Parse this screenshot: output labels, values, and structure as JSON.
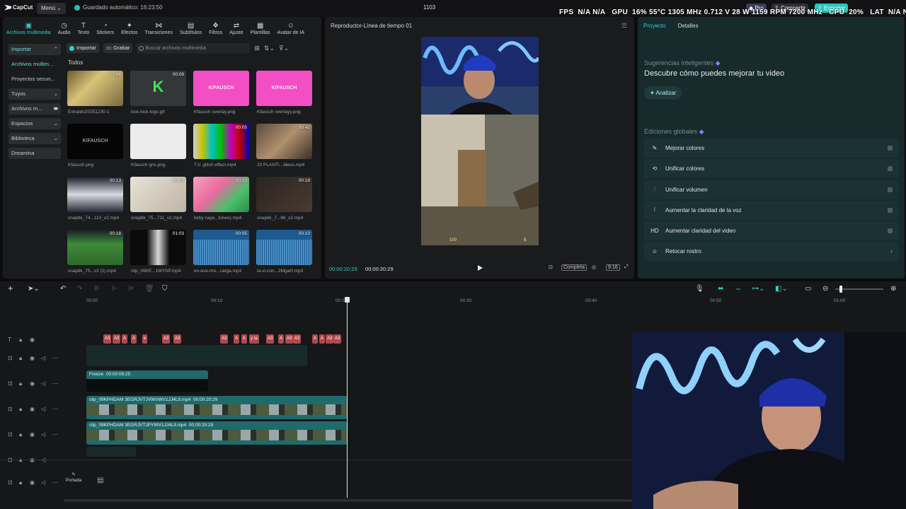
{
  "app": {
    "logo_text": "CapCut",
    "menu_label": "Menú",
    "autosave": "Guardado automático: 16:23:50",
    "title": "1103",
    "pro_label": "Pro",
    "share_label": "Compartir",
    "export_label": "Exportar"
  },
  "overlay": {
    "fps_label": "FPS",
    "fps_value": "N/A N/A",
    "gpu_label": "GPU",
    "gpu_stats": "16% 55°C 1305 MHz 0.712 V 28 W 1159 RPM 7200 MHz",
    "cpu_label": "CPU",
    "cpu_value": "20%",
    "lat_label": "LAT",
    "lat_value": "N/A N/A"
  },
  "toolbar": [
    {
      "label": "Archivos multimedia",
      "icon": "media-icon",
      "glyph": "▣",
      "active": true
    },
    {
      "label": "Audio",
      "icon": "audio-icon",
      "glyph": "◷"
    },
    {
      "label": "Texto",
      "icon": "text-icon",
      "glyph": "T"
    },
    {
      "label": "Stickers",
      "icon": "sticker-icon",
      "glyph": "◔"
    },
    {
      "label": "Efectos",
      "icon": "effects-icon",
      "glyph": "✦"
    },
    {
      "label": "Transiciones",
      "icon": "transitions-icon",
      "glyph": "⋈"
    },
    {
      "label": "Subtítulos",
      "icon": "subtitles-icon",
      "glyph": "▤"
    },
    {
      "label": "Filtros",
      "icon": "filters-icon",
      "glyph": "❖"
    },
    {
      "label": "Ajuste",
      "icon": "adjust-icon",
      "glyph": "⇄"
    },
    {
      "label": "Plantillas",
      "icon": "templates-icon",
      "glyph": "▦"
    },
    {
      "label": "Avatar de IA",
      "icon": "ai-avatar-icon",
      "glyph": "☺"
    }
  ],
  "sidenav": [
    {
      "label": "Importar",
      "chev": "⌃",
      "sel": true,
      "hl": true
    },
    {
      "label": "Archivos multim...",
      "chev": "",
      "hl": true
    },
    {
      "label": "Proyectos secun...",
      "chev": ""
    },
    {
      "label": "Tuyos",
      "chev": "⌄",
      "sel": true
    },
    {
      "label": "Archivos m...",
      "chev": "⬬",
      "sel": true
    },
    {
      "label": "Espacios",
      "chev": "⌄",
      "sel": true
    },
    {
      "label": "Biblioteca",
      "chev": "⌄",
      "sel": true
    },
    {
      "label": "Dreamina",
      "chev": "",
      "sel": true
    }
  ],
  "media": {
    "import_label": "Importar",
    "record_label": "Grabar",
    "search_placeholder": "Buscar archivos multimedia",
    "section_label": "Todos",
    "items": [
      {
        "name": "Extraido20251230-1",
        "dur": "00:06",
        "bg": "linear-gradient(135deg,#6b5a2f,#d8c27a 40%,#7a6a3f)"
      },
      {
        "name": "kick-kick-logo.gif",
        "dur": "00:09",
        "bg": "#34373a",
        "logo": "K",
        "logo_color": "#3ee64a"
      },
      {
        "name": "Kfausch overlay.png",
        "dur": "",
        "bg": "#f14fc3",
        "logo": "K/FAUSCH",
        "logo_color": "#ffe3f6"
      },
      {
        "name": "Kfausch overlayy.png",
        "dur": "",
        "bg": "#f14fc3",
        "logo": "K/FAUSCH",
        "logo_color": "#ffe3f6"
      },
      {
        "name": "Kfausch.png",
        "dur": "",
        "bg": "#050505",
        "logo": "K/FAUSCH",
        "logo_color": "#9a9a9a"
      },
      {
        "name": "Kfausch gris.png",
        "dur": "",
        "bg": "#ececec",
        "logo": "",
        "logo_color": "#cfcfcf"
      },
      {
        "name": "T.V. glitch effect.mp4",
        "dur": "00:05",
        "bg": "linear-gradient(90deg,#cfcfcf,#c8c200,#00c0c8,#00c000,#c000c0,#c00000,#0000c0)"
      },
      {
        "name": "20 PLANTI...ideos.mp4",
        "dur": "00:42",
        "bg": "linear-gradient(135deg,#5a4a3a,#b09070,#3a2f28)"
      },
      {
        "name": "snaptik_74...110_v2.mp4",
        "dur": "00:13",
        "bg": "linear-gradient(180deg,#1b1c2a,#d8d8e0 50%,#2a2a38)"
      },
      {
        "name": "snaptik_75...711_v2.mp4",
        "dur": "00:19",
        "bg": "linear-gradient(135deg,#e8e2d8,#bfb4a4)"
      },
      {
        "name": "kirby caye...lonee).mp4",
        "dur": "00:20",
        "bg": "linear-gradient(135deg,#f8a3c0,#e86aa0 40%,#4bbf6a 70%,#2e8a49)"
      },
      {
        "name": "snaptik_7...96_v2.mp4",
        "dur": "00:18",
        "bg": "linear-gradient(135deg,#2a2420,#4a3a32)"
      },
      {
        "name": "snaptik_75...v2 (1).mp4",
        "dur": "00:18",
        "bg": "linear-gradient(180deg,#1a1d28,#3f8a3a 40%,#2d6a2a)"
      },
      {
        "name": "clip_09KE...1MYSP.mp4",
        "dur": "01:03",
        "bg": "linear-gradient(90deg,#0b0b0b 30%,#d8d8d8 50%,#0b0b0b 70%)"
      },
      {
        "name": "en-ese-mo...carga.mp3",
        "dur": "00:05",
        "bg": "#1e5a8f"
      },
      {
        "name": "la-vi-con...2MgaH.mp3",
        "dur": "00:10",
        "bg": "#1e5a8f"
      }
    ]
  },
  "player": {
    "title": "Reproductor-Línea de tiempo 01",
    "current": "00:00:20:29",
    "total": "00:00:20:29",
    "complete_label": "Completa",
    "ratio_label": "9:16"
  },
  "right": {
    "tab_project": "Proyecto",
    "tab_details": "Detalles",
    "smart_title": "Sugerencias inteligentes",
    "headline": "Descubre cómo puedes mejorar tu video",
    "analyze_label": "Analizar",
    "global_title": "Ediciones globales",
    "items": [
      {
        "label": "Mejorar colores",
        "icon": "enhance-colors-icon",
        "glyph": "✎",
        "type": "toggle"
      },
      {
        "label": "Unificar colores",
        "icon": "unify-colors-icon",
        "glyph": "⟲",
        "type": "toggle"
      },
      {
        "label": "Unificar volumen",
        "icon": "unify-volume-icon",
        "glyph": "⫶",
        "type": "toggle"
      },
      {
        "label": "Aumentar la claridad de la voz",
        "icon": "voice-clarity-icon",
        "glyph": "⦚",
        "type": "toggle"
      },
      {
        "label": "Aumentar claridad del video",
        "icon": "hd-icon",
        "glyph": "HD",
        "type": "toggle"
      },
      {
        "label": "Retocar rostro",
        "icon": "face-retouch-icon",
        "glyph": "☺",
        "type": "chevron"
      }
    ]
  },
  "timeline": {
    "ruler": [
      "00:00",
      "00:10",
      "00:20",
      "00:30",
      "00:40",
      "00:50",
      "01:00"
    ],
    "text_chips": [
      "A3",
      "A3",
      "A",
      "A",
      "e",
      "A3",
      "A3",
      "A3",
      "A",
      "A",
      "y ta",
      "A3",
      "A",
      "A3",
      "A3",
      "A",
      "A",
      "A3",
      "A3"
    ],
    "freeze_label": "Freeze",
    "freeze_dur": "00:00:09:25",
    "clip1_name": "clip_09KPHDAM 3EGRJVTJVWVWV1JJ4L9.mp4",
    "clip1_dur": "00:00:20:29",
    "clip2_name": "clip_09KPHDAM 3EGRJVTJPYWV1JJ4L9.mp4",
    "clip2_dur": "00:00:20:29",
    "cover_label": "Portada"
  }
}
